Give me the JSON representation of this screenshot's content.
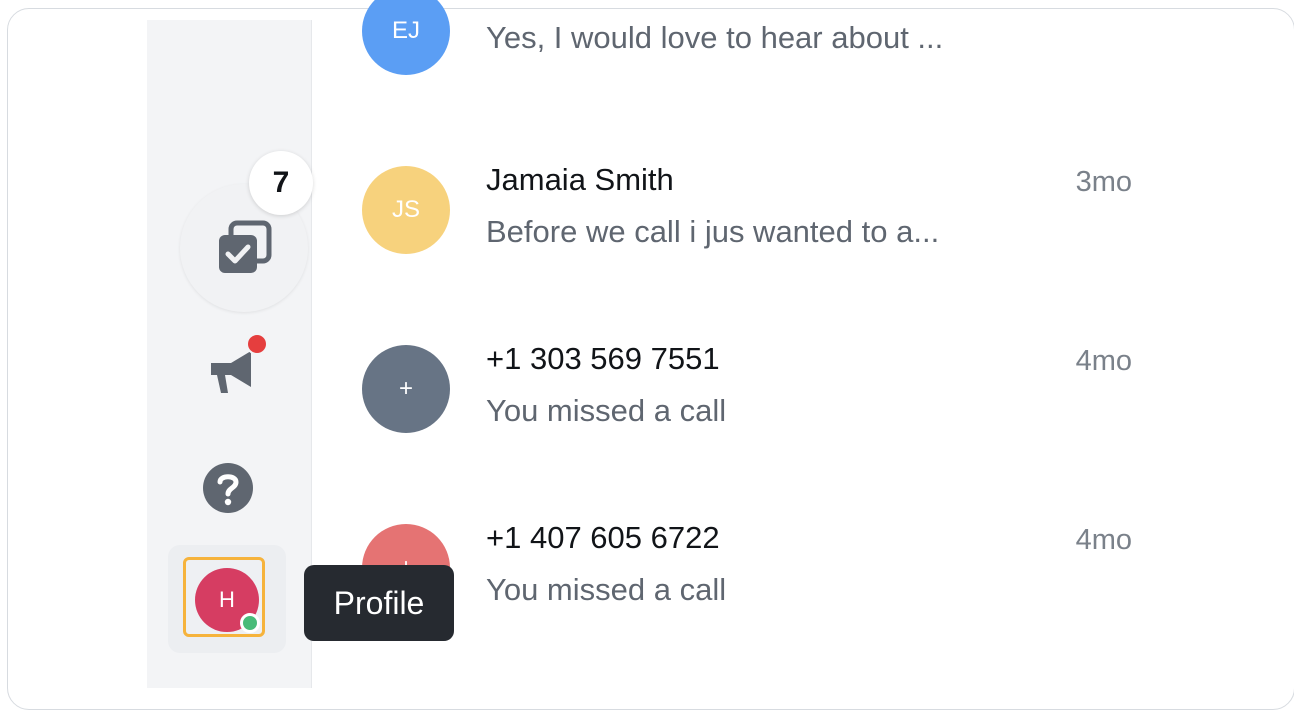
{
  "sidebar": {
    "tasks_badge_count": "7",
    "tooltip_label": "Profile",
    "profile_initial": "H"
  },
  "conversations": [
    {
      "initials": "EJ",
      "name": "",
      "preview": "Yes, I would love to hear about ...",
      "time": "",
      "color": "#5b9ef4"
    },
    {
      "initials": "JS",
      "name": "Jamaia Smith",
      "preview": "Before we call i jus wanted to a...",
      "time": "3mo",
      "color": "#f7d27d"
    },
    {
      "initials": "+",
      "name": "+1 303 569 7551",
      "preview": "You missed a call",
      "time": "4mo",
      "color": "#677485"
    },
    {
      "initials": "+",
      "name": "+1 407 605 6722",
      "preview": "You missed a call",
      "time": "4mo",
      "color": "#e57373"
    }
  ],
  "colors": {
    "accent_outline": "#f6b33c",
    "notification_dot": "#e53e3e",
    "online_dot": "#48bb78"
  }
}
